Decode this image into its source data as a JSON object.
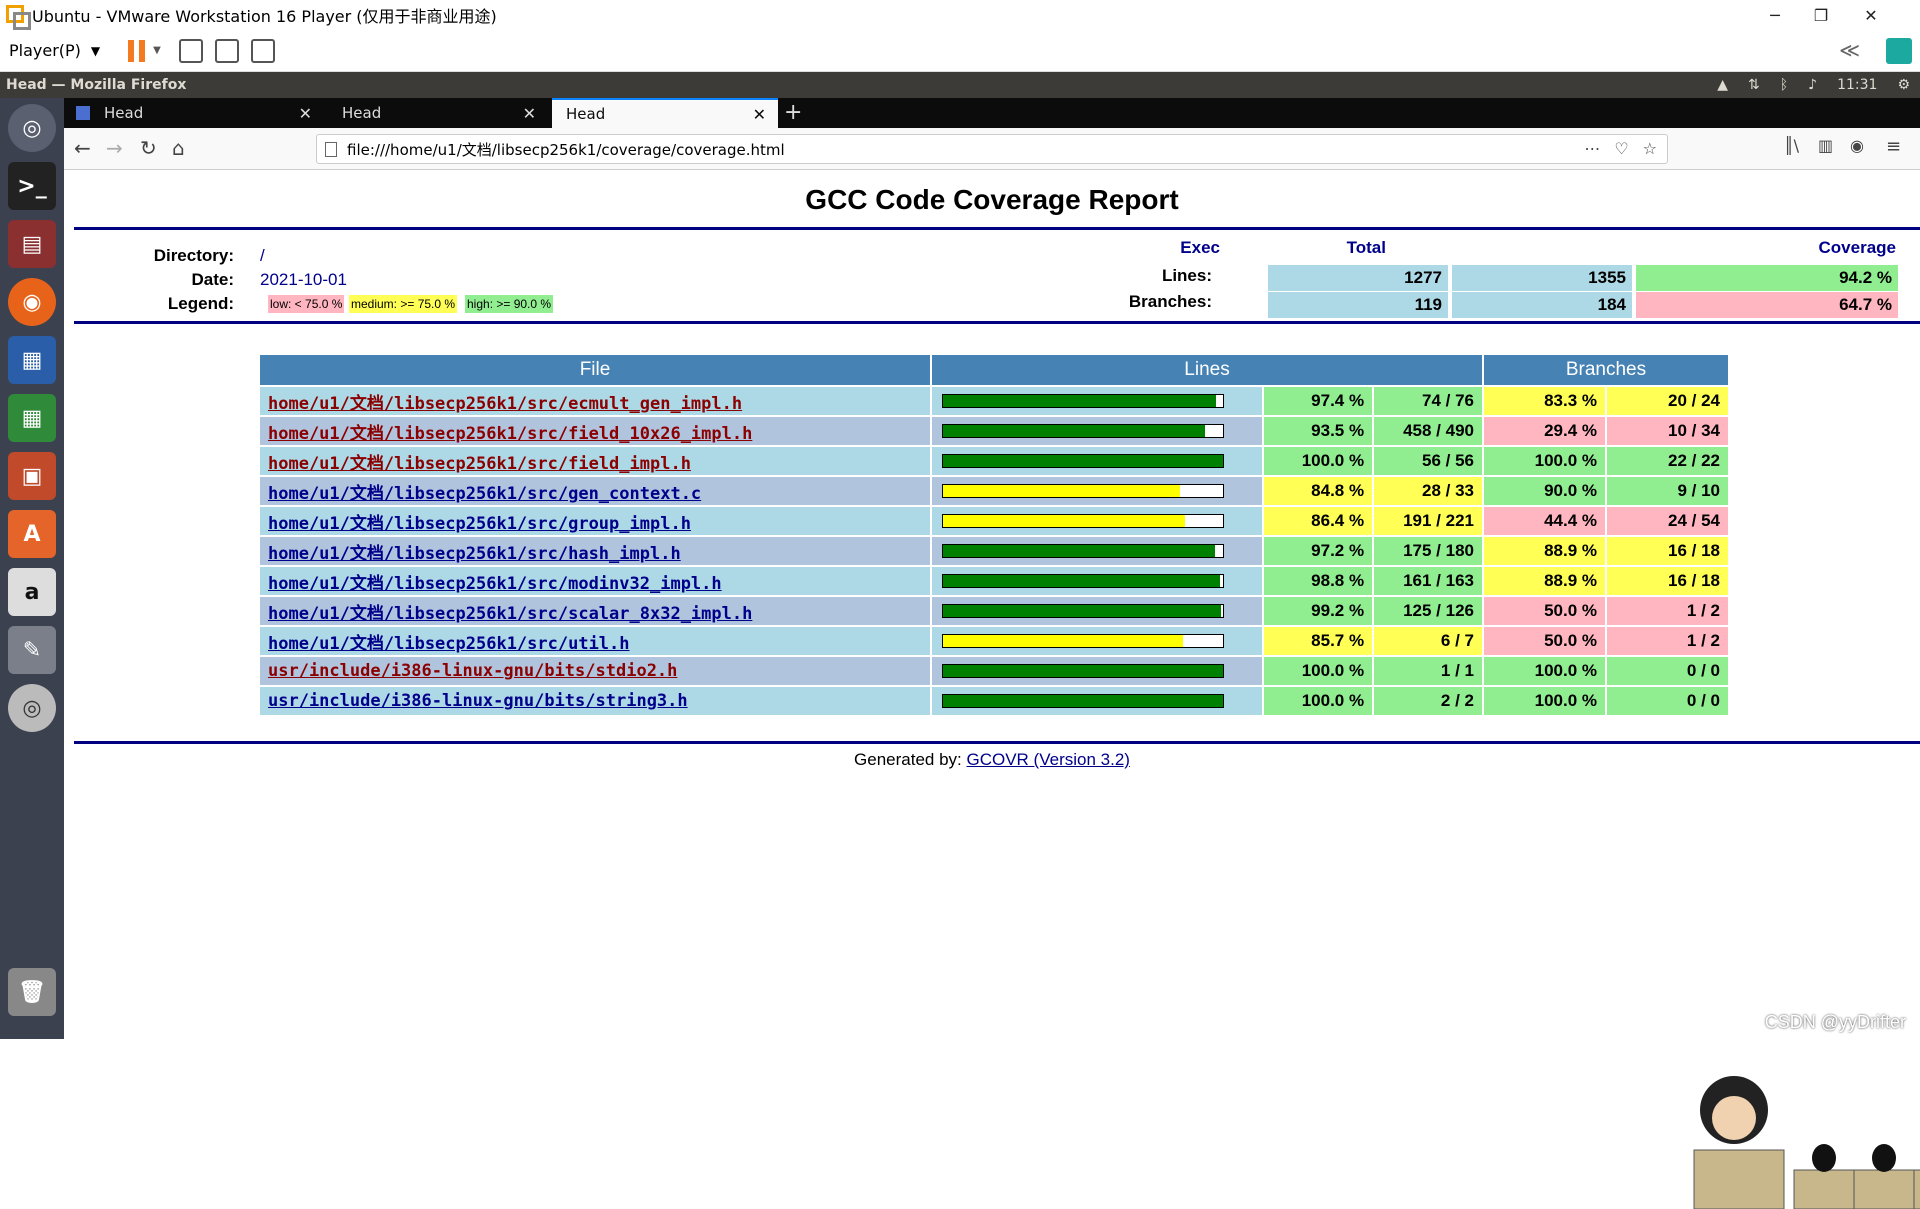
{
  "vmware": {
    "title": "Ubuntu - VMware Workstation 16 Player (仅用于非商业用途)",
    "player_menu": "Player(P)"
  },
  "ubuntu_panel": {
    "window_title": "Head — Mozilla Firefox",
    "clock": "11:31"
  },
  "tabs": [
    {
      "label": "Head"
    },
    {
      "label": "Head"
    },
    {
      "label": "Head"
    }
  ],
  "url": "file:///home/u1/文档/libsecp256k1/coverage/coverage.html",
  "report": {
    "title": "GCC Code Coverage Report",
    "directory_label": "Directory:",
    "directory_value": "/",
    "date_label": "Date:",
    "date_value": "2021-10-01",
    "legend_label": "Legend:",
    "legend_low": "low: < 75.0 %",
    "legend_medium": "medium: >= 75.0 %",
    "legend_high": "high: >= 90.0 %",
    "colors": {
      "low": "#ffb6c1",
      "medium": "#ffff55",
      "high": "#90ee90",
      "neutral": "#add8e6",
      "header": "#4682b4",
      "link": "#00008b",
      "link_low": "#8b0000"
    },
    "summary": {
      "col_exec": "Exec",
      "col_total": "Total",
      "col_coverage": "Coverage",
      "lines_label": "Lines:",
      "lines_exec": "1277",
      "lines_total": "1355",
      "lines_coverage": "94.2 %",
      "branches_label": "Branches:",
      "branches_exec": "119",
      "branches_total": "184",
      "branches_coverage": "64.7 %"
    },
    "table_headers": {
      "file": "File",
      "lines": "Lines",
      "branches": "Branches"
    },
    "rows": [
      {
        "file": "home/u1/文档/libsecp256k1/src/ecmult_gen_impl.h",
        "line_pct": 97.4,
        "line_pct_text": "97.4 %",
        "line_count": "74 / 76",
        "branch_pct_text": "83.3 %",
        "branch_count": "20 / 24",
        "line_level": "high",
        "branch_level": "medium",
        "link_level": "low"
      },
      {
        "file": "home/u1/文档/libsecp256k1/src/field_10x26_impl.h",
        "line_pct": 93.5,
        "line_pct_text": "93.5 %",
        "line_count": "458 / 490",
        "branch_pct_text": "29.4 %",
        "branch_count": "10 / 34",
        "line_level": "high",
        "branch_level": "low",
        "link_level": "low"
      },
      {
        "file": "home/u1/文档/libsecp256k1/src/field_impl.h",
        "line_pct": 100.0,
        "line_pct_text": "100.0 %",
        "line_count": "56 / 56",
        "branch_pct_text": "100.0 %",
        "branch_count": "22 / 22",
        "line_level": "high",
        "branch_level": "high",
        "link_level": "low"
      },
      {
        "file": "home/u1/文档/libsecp256k1/src/gen_context.c",
        "line_pct": 84.8,
        "line_pct_text": "84.8 %",
        "line_count": "28 / 33",
        "branch_pct_text": "90.0 %",
        "branch_count": "9 / 10",
        "line_level": "medium",
        "branch_level": "high",
        "link_level": "normal"
      },
      {
        "file": "home/u1/文档/libsecp256k1/src/group_impl.h",
        "line_pct": 86.4,
        "line_pct_text": "86.4 %",
        "line_count": "191 / 221",
        "branch_pct_text": "44.4 %",
        "branch_count": "24 / 54",
        "line_level": "medium",
        "branch_level": "low",
        "link_level": "normal"
      },
      {
        "file": "home/u1/文档/libsecp256k1/src/hash_impl.h",
        "line_pct": 97.2,
        "line_pct_text": "97.2 %",
        "line_count": "175 / 180",
        "branch_pct_text": "88.9 %",
        "branch_count": "16 / 18",
        "line_level": "high",
        "branch_level": "medium",
        "link_level": "normal"
      },
      {
        "file": "home/u1/文档/libsecp256k1/src/modinv32_impl.h",
        "line_pct": 98.8,
        "line_pct_text": "98.8 %",
        "line_count": "161 / 163",
        "branch_pct_text": "88.9 %",
        "branch_count": "16 / 18",
        "line_level": "high",
        "branch_level": "medium",
        "link_level": "normal"
      },
      {
        "file": "home/u1/文档/libsecp256k1/src/scalar_8x32_impl.h",
        "line_pct": 99.2,
        "line_pct_text": "99.2 %",
        "line_count": "125 / 126",
        "branch_pct_text": "50.0 %",
        "branch_count": "1 / 2",
        "line_level": "high",
        "branch_level": "low",
        "link_level": "normal"
      },
      {
        "file": "home/u1/文档/libsecp256k1/src/util.h",
        "line_pct": 85.7,
        "line_pct_text": "85.7 %",
        "line_count": "6 / 7",
        "branch_pct_text": "50.0 %",
        "branch_count": "1 / 2",
        "line_level": "medium",
        "branch_level": "low",
        "link_level": "normal"
      },
      {
        "file": "usr/include/i386-linux-gnu/bits/stdio2.h",
        "line_pct": 100.0,
        "line_pct_text": "100.0 %",
        "line_count": "1 / 1",
        "branch_pct_text": "100.0 %",
        "branch_count": "0 / 0",
        "line_level": "high",
        "branch_level": "high",
        "link_level": "low"
      },
      {
        "file": "usr/include/i386-linux-gnu/bits/string3.h",
        "line_pct": 100.0,
        "line_pct_text": "100.0 %",
        "line_count": "2 / 2",
        "branch_pct_text": "100.0 %",
        "branch_count": "0 / 0",
        "line_level": "high",
        "branch_level": "high",
        "link_level": "normal"
      }
    ],
    "footer_prefix": "Generated by: ",
    "footer_link": "GCOVR (Version 3.2)"
  },
  "watermark": "CSDN @yyDrifter"
}
